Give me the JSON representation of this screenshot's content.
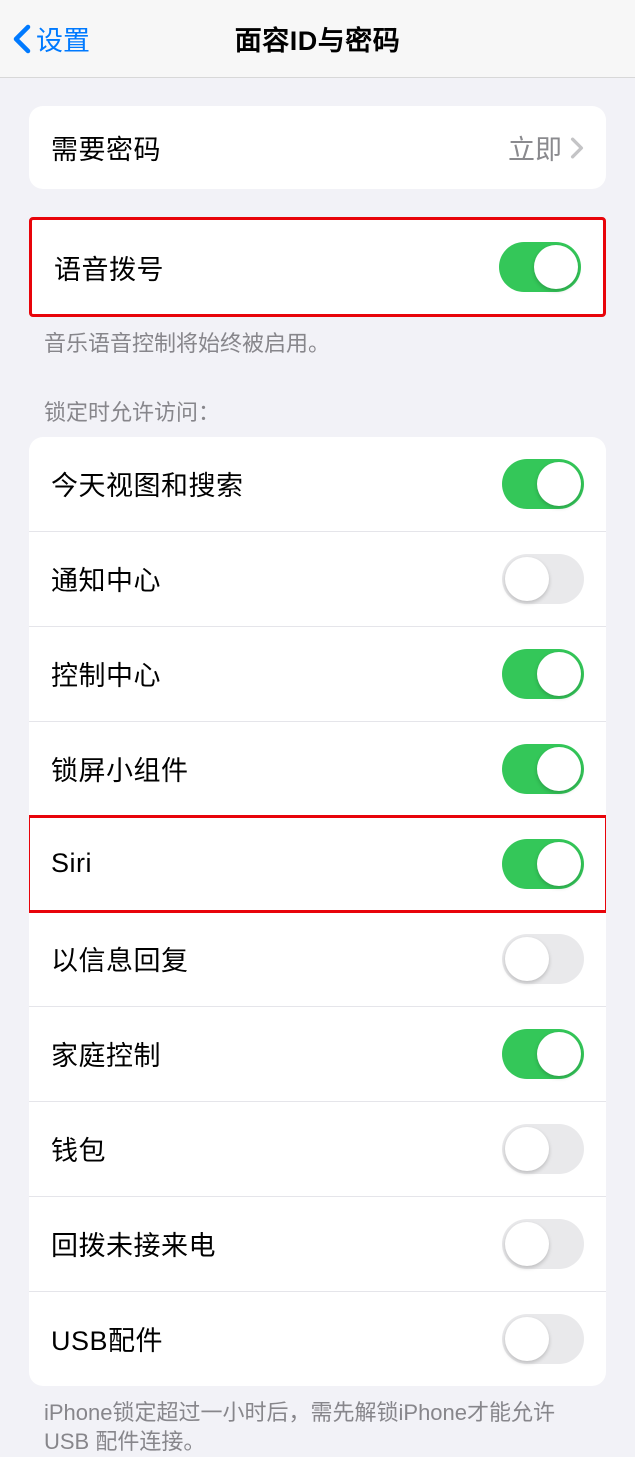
{
  "nav": {
    "back_label": "设置",
    "title": "面容ID与密码"
  },
  "require_passcode": {
    "label": "需要密码",
    "value": "立即"
  },
  "voice_dial": {
    "label": "语音拨号",
    "on": true,
    "footer": "音乐语音控制将始终被启用。"
  },
  "lock_access": {
    "header": "锁定时允许访问：",
    "items": [
      {
        "label": "今天视图和搜索",
        "on": true,
        "highlight": false
      },
      {
        "label": "通知中心",
        "on": false,
        "highlight": false
      },
      {
        "label": "控制中心",
        "on": true,
        "highlight": false
      },
      {
        "label": "锁屏小组件",
        "on": true,
        "highlight": false
      },
      {
        "label": "Siri",
        "on": true,
        "highlight": true
      },
      {
        "label": "以信息回复",
        "on": false,
        "highlight": false
      },
      {
        "label": "家庭控制",
        "on": true,
        "highlight": false
      },
      {
        "label": "钱包",
        "on": false,
        "highlight": false
      },
      {
        "label": "回拨未接来电",
        "on": false,
        "highlight": false
      },
      {
        "label": "USB配件",
        "on": false,
        "highlight": false
      }
    ],
    "footer": "iPhone锁定超过一小时后，需先解锁iPhone才能允许USB 配件连接。"
  }
}
